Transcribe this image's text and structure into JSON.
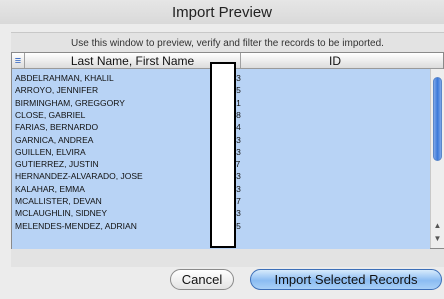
{
  "window": {
    "title": "Import Preview"
  },
  "instruction": "Use this window to preview, verify and filter the records to be imported.",
  "table": {
    "columns": {
      "menu": "≡",
      "name": "Last Name, First Name",
      "id": "ID"
    },
    "rows": [
      {
        "name": "ABDELRAHMAN, KHALIL",
        "id": "3133"
      },
      {
        "name": "ARROYO, JENNIFER",
        "id": "2255"
      },
      {
        "name": "BIRMINGHAM, GREGGORY",
        "id": "2121"
      },
      {
        "name": "CLOSE, GABRIEL",
        "id": "4508"
      },
      {
        "name": "FARIAS, BERNARDO",
        "id": "3724"
      },
      {
        "name": "GARNICA, ANDREA",
        "id": "2793"
      },
      {
        "name": "GUILLEN, ELVIRA",
        "id": "2253"
      },
      {
        "name": "GUTIERREZ, JUSTIN",
        "id": "1177"
      },
      {
        "name": "HERNANDEZ-ALVARADO, JOSE",
        "id": "7713"
      },
      {
        "name": "KALAHAR, EMMA",
        "id": "1253"
      },
      {
        "name": "MCALLISTER, DEVAN",
        "id": "9327"
      },
      {
        "name": "MCLAUGHLIN, SIDNEY",
        "id": "1213"
      },
      {
        "name": "MELENDES-MENDEZ, ADRIAN",
        "id": "7525"
      }
    ]
  },
  "scrollbar": {
    "up_icon": "arrow-up-icon",
    "down_icon": "arrow-down-icon"
  },
  "buttons": {
    "cancel": "Cancel",
    "import": "Import Selected Records"
  },
  "colors": {
    "selection": "#b8d3f5",
    "accent": "#3a78d9"
  }
}
